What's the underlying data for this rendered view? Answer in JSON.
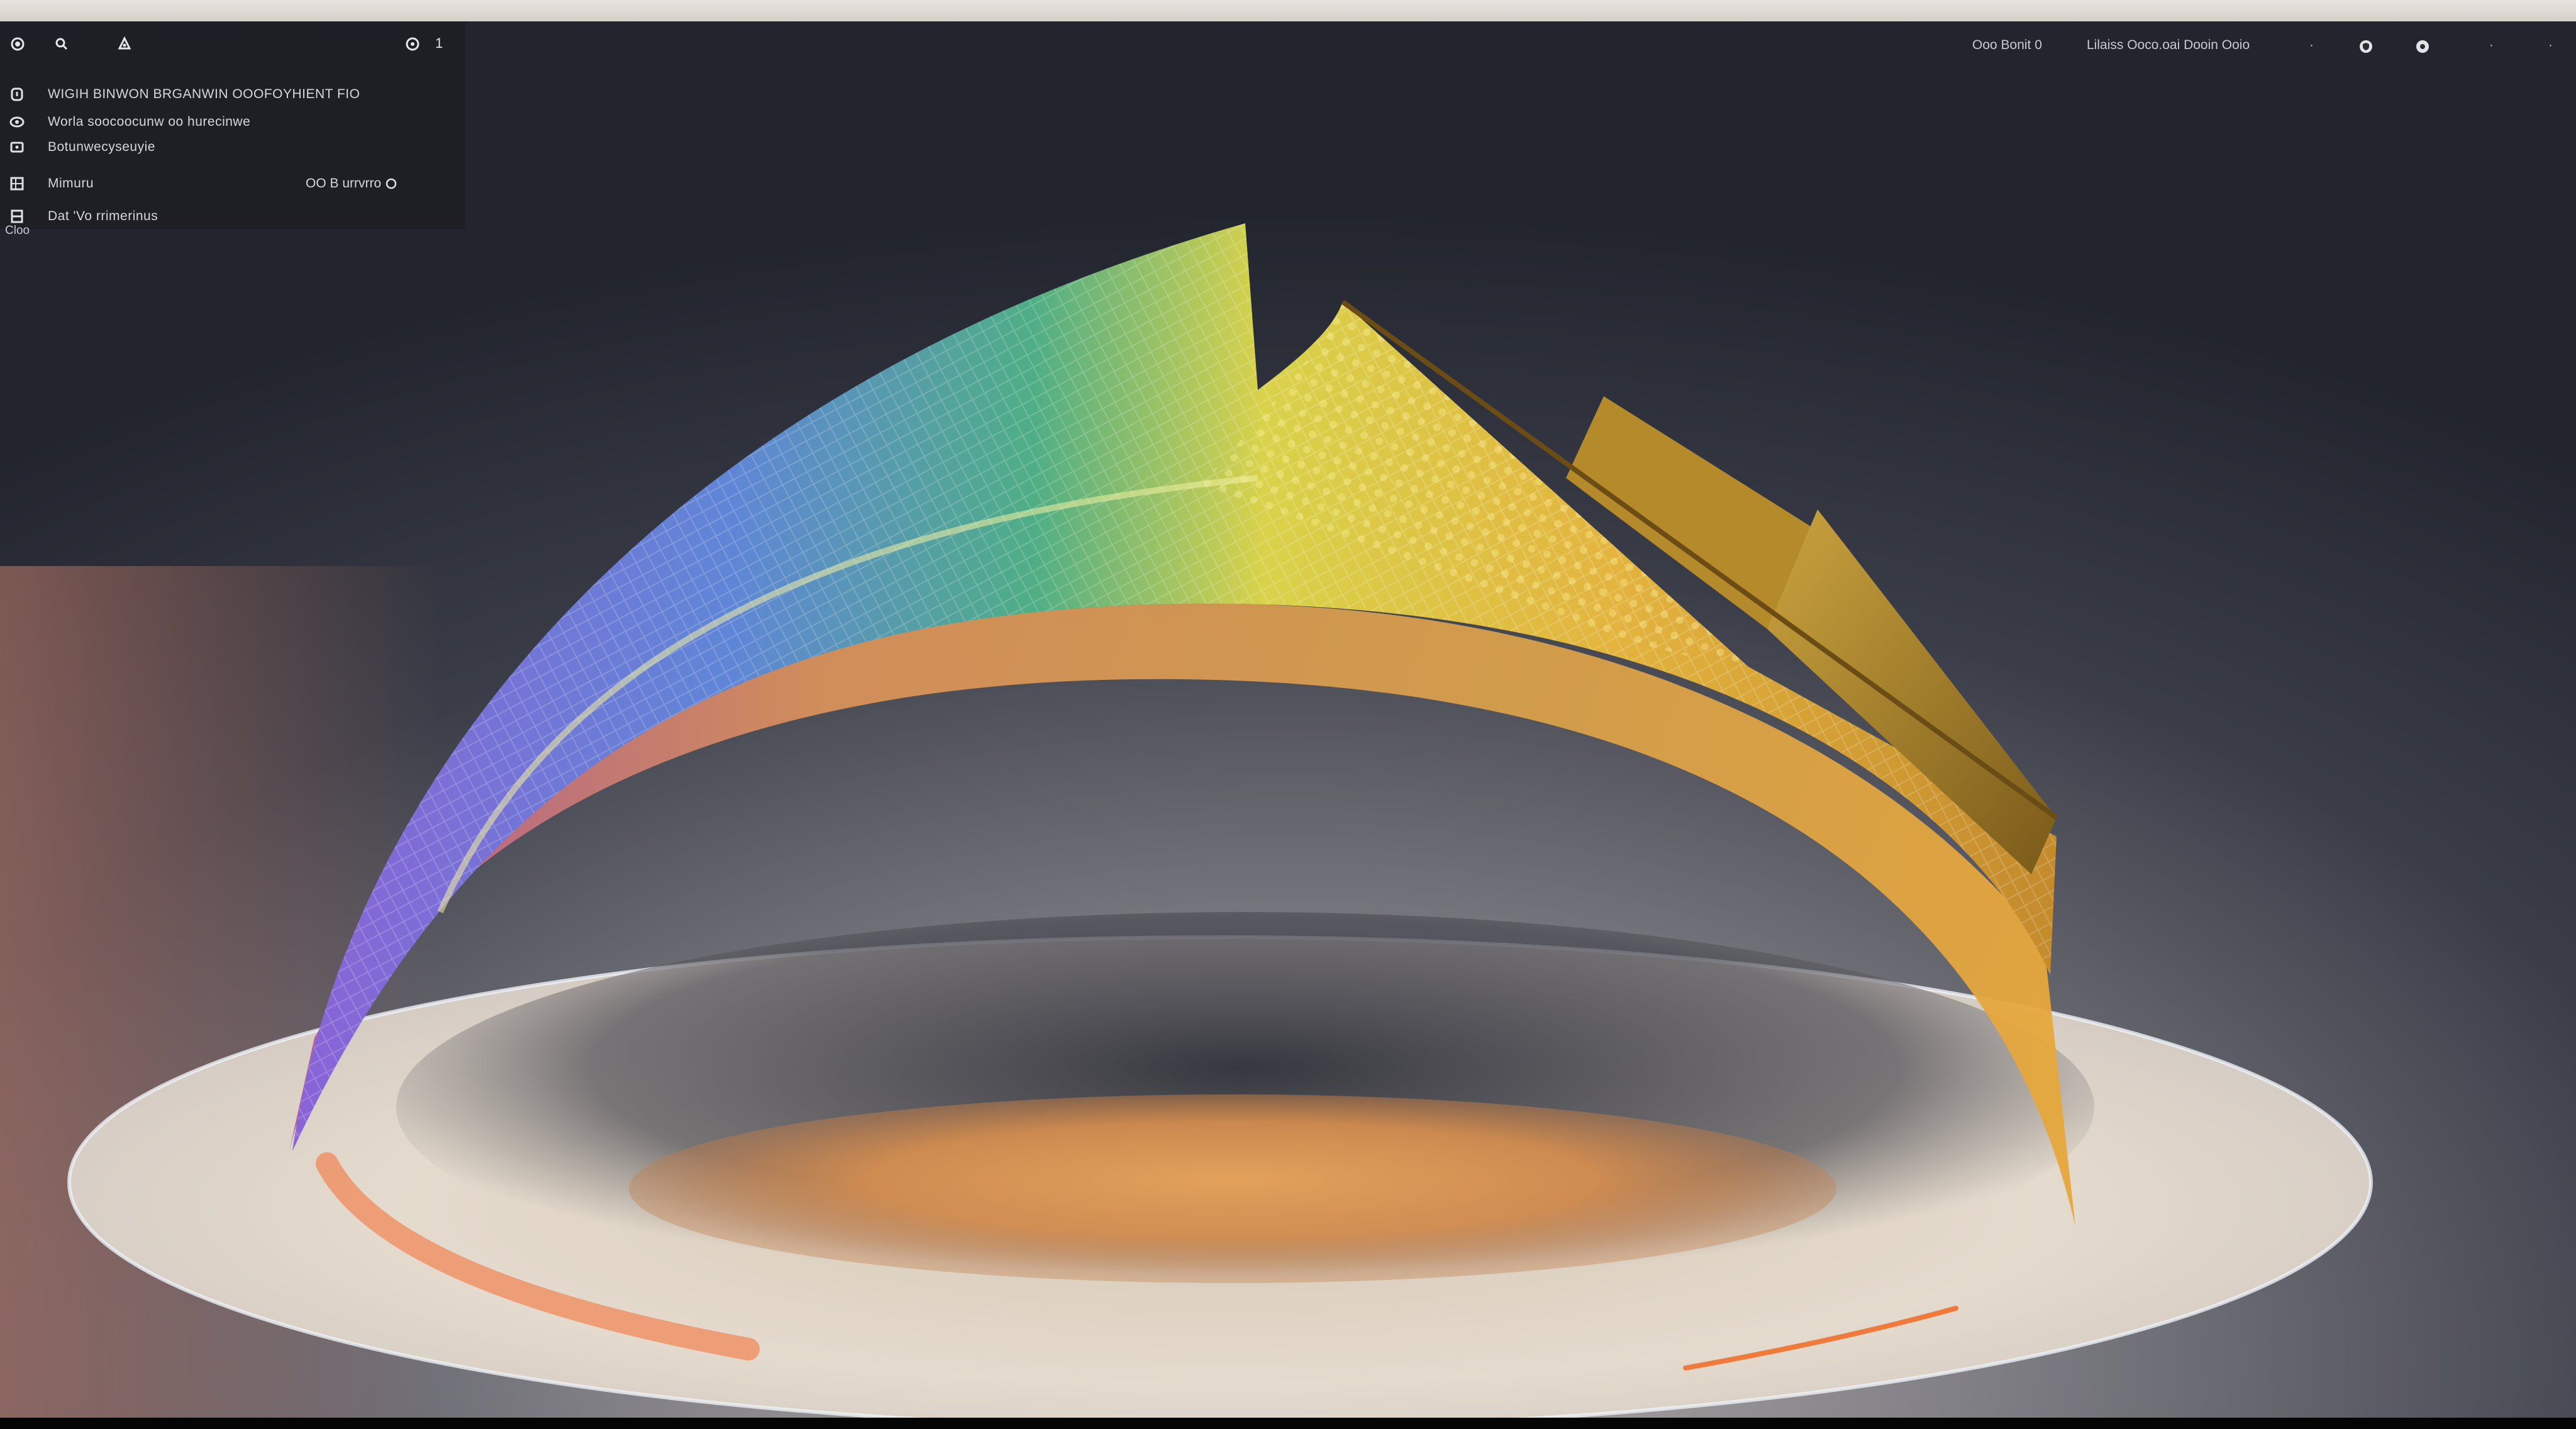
{
  "panel": {
    "toolbar": {
      "count": "1"
    },
    "rows": [
      {
        "label": "WIGIH BINWON BRGANWIN OOOFOYHIENT FIO",
        "value": ""
      },
      {
        "label": "Worla soocoocunw oo hurecinwe",
        "value": ""
      },
      {
        "label": "Botunwecyseuyie",
        "value": ""
      },
      {
        "label": "Mimuru",
        "value": "OO B urrvrro"
      },
      {
        "label": "Dat 'Vo rrimerinus",
        "value": ""
      }
    ],
    "footer": "Cloo"
  },
  "status": {
    "text_left": "Ooo Bonit 0",
    "text_right": "Lilaiss Ooco.oai Dooin Ooio",
    "dot_1": "·",
    "dot_2": "·",
    "dot_3": "·"
  },
  "colors": {
    "panel_bg": "#1e1f24",
    "background_top": "#23262f",
    "accent_orange": "#f07a3c",
    "accent_gold": "#e8a53a",
    "accent_purple": "#8c6ad8"
  },
  "icons": {
    "toolbar": [
      "record-icon",
      "search-icon",
      "user-icon",
      "timer-icon"
    ],
    "rows": [
      "info-icon",
      "eye-icon",
      "image-icon",
      "grid-icon",
      "save-icon"
    ],
    "status": [
      "shield-icon",
      "gear-icon"
    ]
  }
}
